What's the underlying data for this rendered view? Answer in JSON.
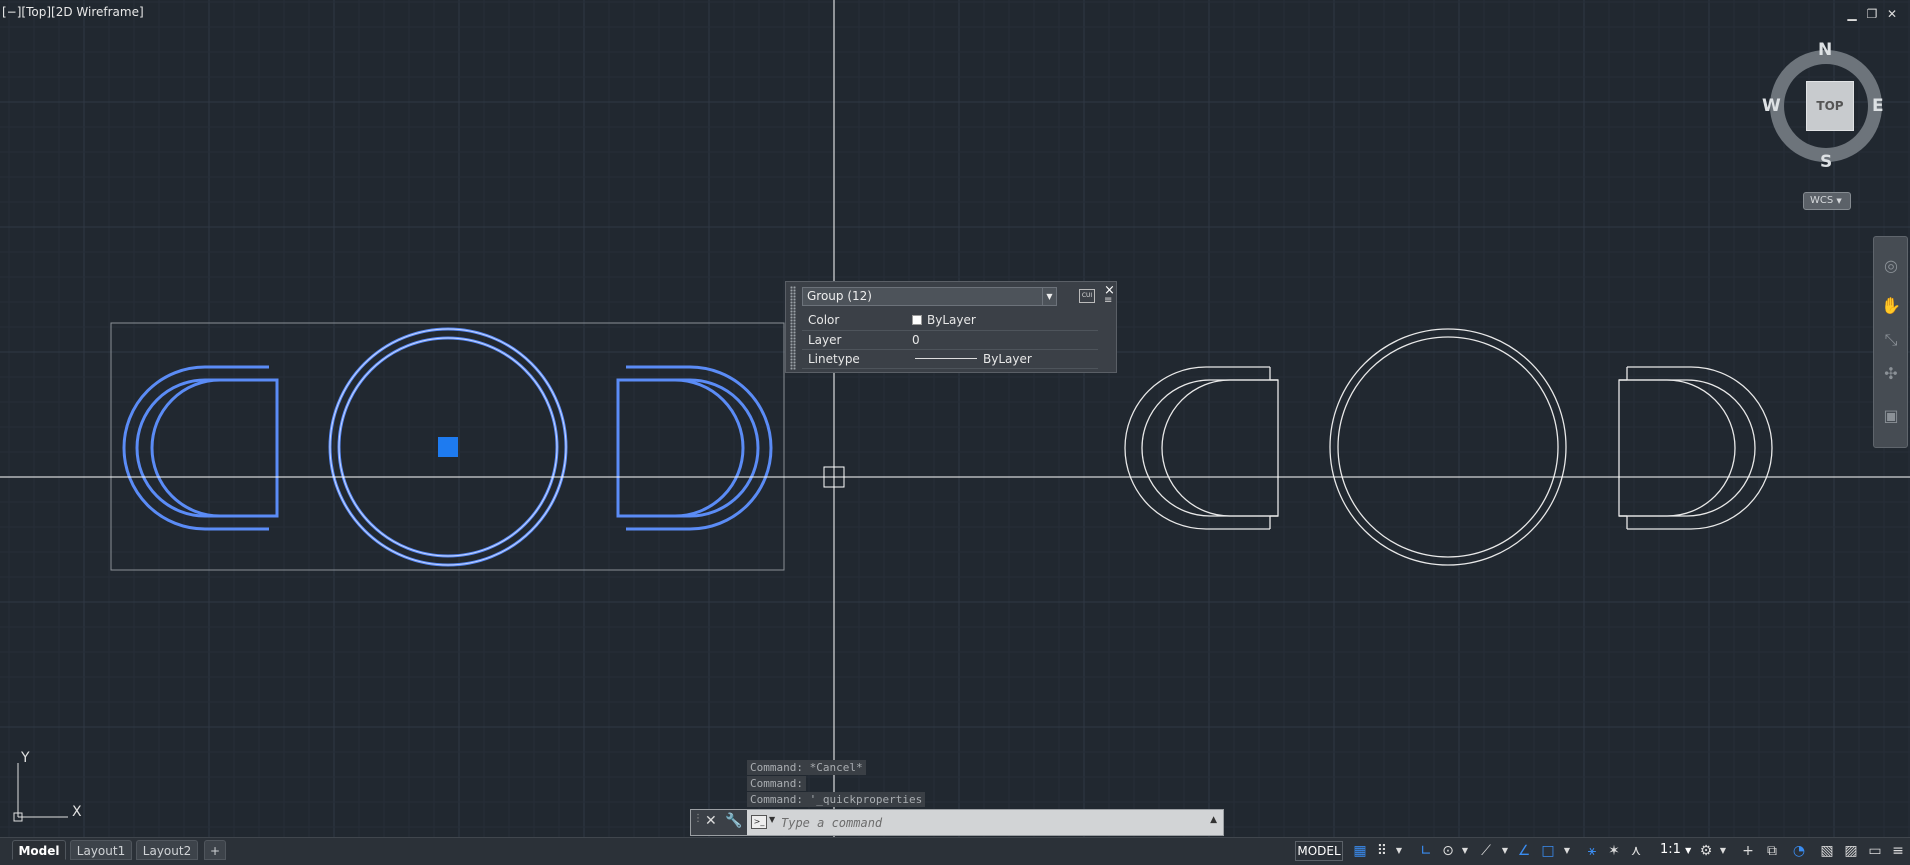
{
  "viewport": {
    "controls_label": "[−][Top][2D Wireframe]",
    "window_buttons": {
      "minimize": "▁",
      "restore": "❐",
      "close": "✕"
    }
  },
  "quick_properties": {
    "selection": "Group (12)",
    "rows": [
      {
        "label": "Color",
        "value": "ByLayer"
      },
      {
        "label": "Layer",
        "value": "0"
      },
      {
        "label": "Linetype",
        "value": "ByLayer"
      }
    ],
    "close": "×",
    "cui_label": "CUI"
  },
  "viewcube": {
    "top": "TOP",
    "n": "N",
    "s": "S",
    "e": "E",
    "w": "W",
    "wcs": "WCS"
  },
  "ucs": {
    "x": "X",
    "y": "Y"
  },
  "command": {
    "history": [
      "Command: *Cancel*",
      "Command:",
      "Command: '_quickproperties"
    ],
    "placeholder": "Type a command"
  },
  "layout_tabs": [
    "Model",
    "Layout1",
    "Layout2"
  ],
  "add_tab": "+",
  "status": {
    "space": "MODEL",
    "scale": "1:1"
  },
  "colors": {
    "background": "#212830",
    "selection_blue": "#5b8cf6",
    "grip_blue": "#1e7bf0",
    "geometry_white": "#ffffff"
  }
}
